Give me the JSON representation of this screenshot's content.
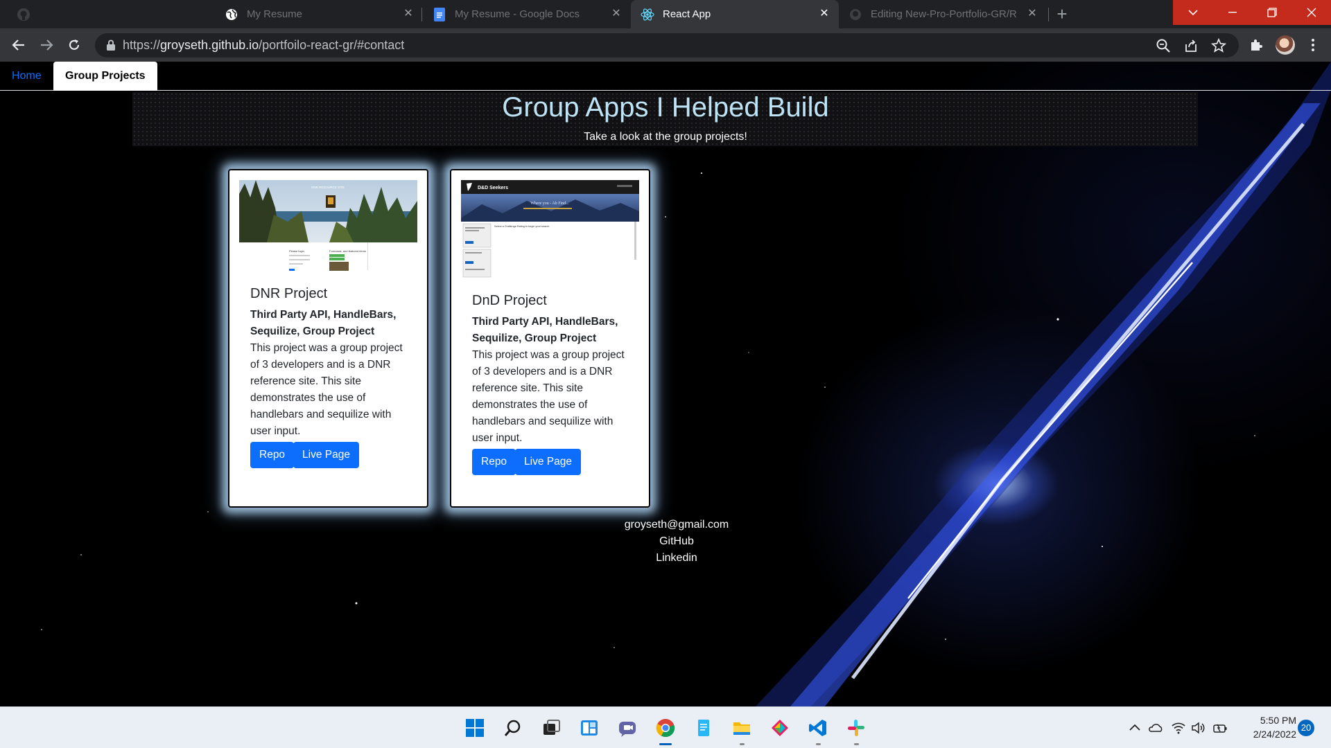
{
  "browser": {
    "tabs": [
      {
        "title": "My Resume",
        "icon": "globe-icon",
        "active": false
      },
      {
        "title": "My Resume - Google Docs",
        "icon": "google-docs-icon",
        "active": false
      },
      {
        "title": "React App",
        "icon": "react-icon",
        "active": true
      },
      {
        "title": "Editing New-Pro-Portfolio-GR/R",
        "icon": "github-icon",
        "active": false
      }
    ],
    "url_scheme": "https://",
    "url_host": "groyseth.github.io",
    "url_path": "/portfoilo-react-gr/#contact"
  },
  "site": {
    "nav": [
      {
        "label": "Home",
        "active": false
      },
      {
        "label": "Group Projects",
        "active": true
      }
    ],
    "hero_title": "Group Apps I Helped Build",
    "hero_subtitle": "Take a look at the group projects!",
    "cards": [
      {
        "title": "DNR Project",
        "tags": "Third Party API, HandleBars, Sequilize, Group Project",
        "text": "This project was a group project of 3 developers and is a DNR reference site. This site demonstrates the use of handlebars and sequilize with user input.",
        "repo_label": "Repo",
        "live_label": "Live Page",
        "thumb": {
          "banner": "DNR RESOURCE SITE",
          "login": "Please login",
          "forecast": "Forecasts, and featured items"
        }
      },
      {
        "title": "DnD Project",
        "tags": "Third Party API, HandleBars, Sequilize, Group Project",
        "text": "This project was a group project of 3 developers and is a DNR reference site. This site demonstrates the use of handlebars and sequilize with user input.",
        "repo_label": "Repo",
        "live_label": "Live Page",
        "thumb": {
          "brand": "D&D Seekers",
          "tagline": "Where you - Ah Find...",
          "prompt": "Select a Challenge Rating to begin your search"
        }
      }
    ],
    "contact": {
      "email": "groyseth@gmail.com",
      "github": "GitHub",
      "linkedin": "Linkedin"
    }
  },
  "taskbar": {
    "apps": [
      "windows-start-icon",
      "search-icon",
      "task-view-icon",
      "widgets-icon",
      "teams-chat-icon",
      "chrome-icon",
      "notepad-icon",
      "file-explorer-icon",
      "gitkraken-icon",
      "vscode-icon",
      "slack-icon"
    ],
    "time": "5:50 PM",
    "date": "2/24/2022",
    "notification_count": "20"
  },
  "colors": {
    "link_blue": "#0d6efd",
    "hero_title": "#bde3f5",
    "close_red": "#c42b1c"
  }
}
